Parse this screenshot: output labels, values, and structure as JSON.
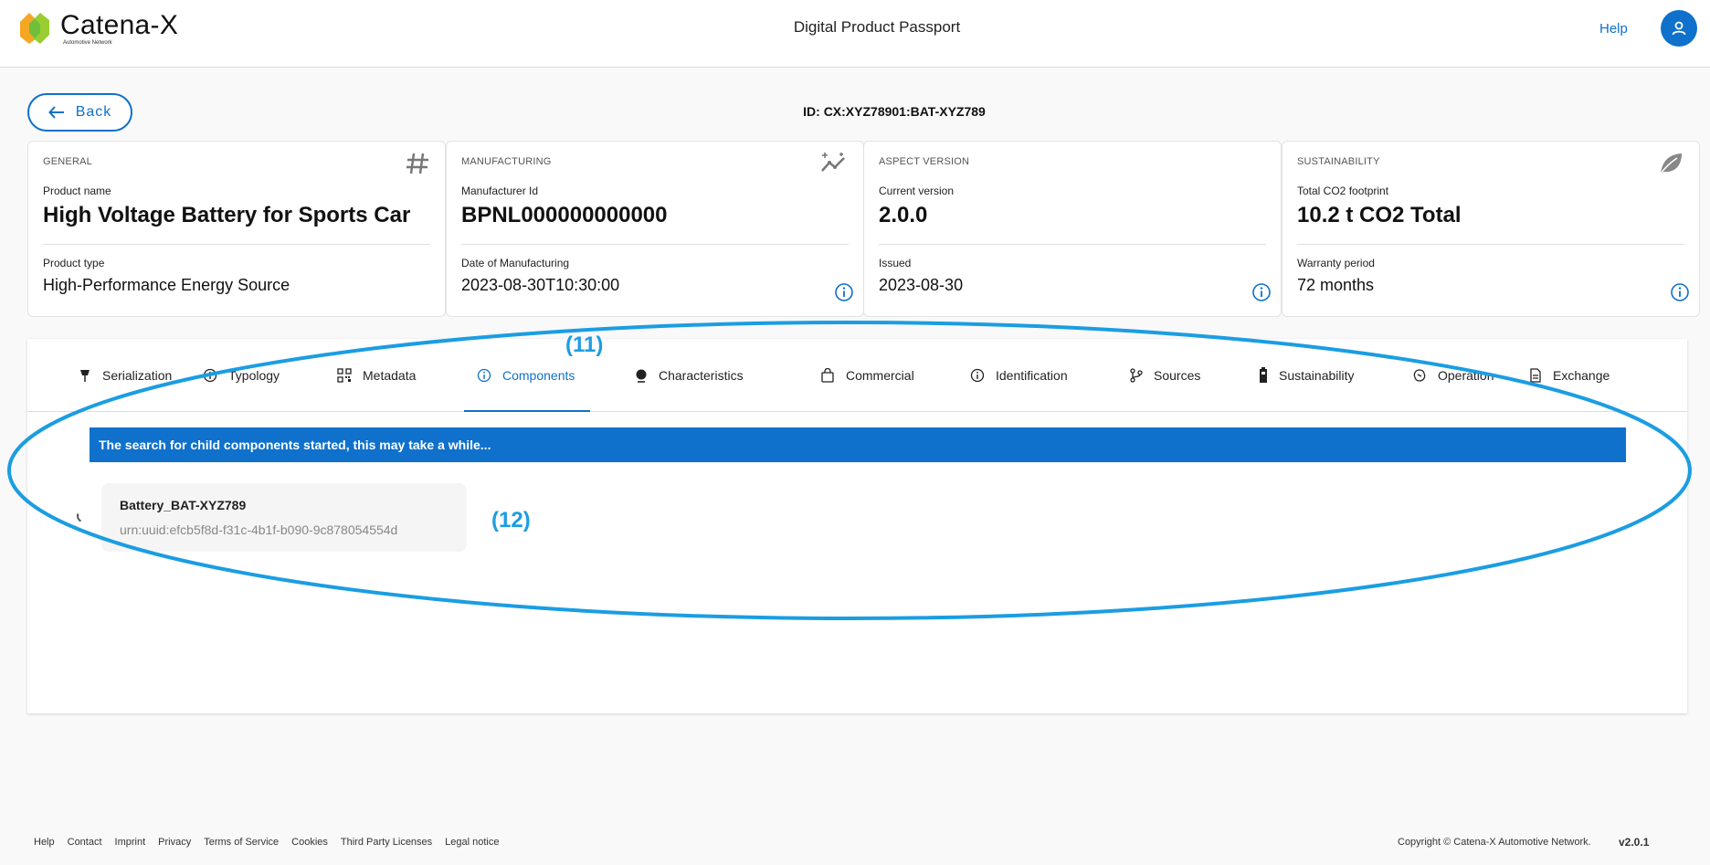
{
  "header": {
    "logo_name": "Catena-X",
    "logo_tagline": "Automotive Network",
    "app_title": "Digital Product Passport",
    "help_label": "Help",
    "brand_color": "#0f71cb"
  },
  "back_label": "Back",
  "passport_id": "ID: CX:XYZ78901:BAT-XYZ789",
  "cards": [
    {
      "category": "GENERAL",
      "icon": "hash-icon",
      "label1": "Product name",
      "value1": "High Voltage Battery for Sports Car",
      "label2": "Product type",
      "value2": "High-Performance Energy Source"
    },
    {
      "category": "MANUFACTURING",
      "icon": "trend-chart-icon",
      "label1": "Manufacturer Id",
      "value1": "BPNL000000000000",
      "label2": "Date of Manufacturing",
      "value2": "2023-08-30T10:30:00"
    },
    {
      "category": "ASPECT VERSION",
      "icon": "",
      "label1": "Current version",
      "value1": "2.0.0",
      "label2": "Issued",
      "value2": "2023-08-30"
    },
    {
      "category": "SUSTAINABILITY",
      "icon": "leaf-icon",
      "label1": "Total CO2 footprint",
      "value1": "10.2 t CO2 Total",
      "label2": "Warranty period",
      "value2": "72 months"
    }
  ],
  "tabs": [
    {
      "label": "Serialization",
      "icon": "pin-icon"
    },
    {
      "label": "Typology",
      "icon": "info-icon"
    },
    {
      "label": "Metadata",
      "icon": "qr-code-icon"
    },
    {
      "label": "Components",
      "icon": "info-icon",
      "active": true
    },
    {
      "label": "Characteristics",
      "icon": "thermometer-icon"
    },
    {
      "label": "Commercial",
      "icon": "shopping-bag-icon"
    },
    {
      "label": "Identification",
      "icon": "info-icon"
    },
    {
      "label": "Sources",
      "icon": "branch-icon"
    },
    {
      "label": "Sustainability",
      "icon": "battery-icon"
    },
    {
      "label": "Operation",
      "icon": "recycle-icon"
    },
    {
      "label": "Exchange",
      "icon": "document-icon"
    }
  ],
  "components": {
    "alert_text": "The search for child components started, this may take a while...",
    "items": [
      {
        "name": "Battery_BAT-XYZ789",
        "urn": "urn:uuid:efcb5f8d-f31c-4b1f-b090-9c878054554d"
      }
    ]
  },
  "annotations": {
    "label_11": "(11)",
    "label_12": "(12)",
    "color": "#1b9de2"
  },
  "footer": {
    "links": [
      "Help",
      "Contact",
      "Imprint",
      "Privacy",
      "Terms of Service",
      "Cookies",
      "Third Party Licenses",
      "Legal notice"
    ],
    "copyright": "Copyright © Catena-X Automotive Network.",
    "version": "v2.0.1"
  }
}
